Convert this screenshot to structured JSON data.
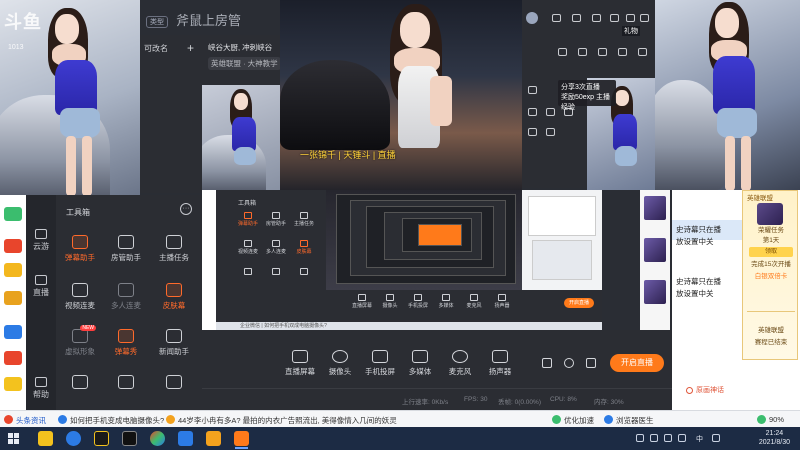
{
  "logo": {
    "mark": "斗鱼",
    "room": "1013"
  },
  "title_band": {
    "tag": "类型",
    "text": "斧鼠上房管"
  },
  "mid_panel": {
    "label": "可改名",
    "label2": "峡谷大厨, 冲刺峡谷",
    "add": "+"
  },
  "chat_panel": {
    "line1": "峡谷大厨, 冲刺峡谷",
    "line2": "英雄联盟 · 大神教学"
  },
  "popup": {
    "line1": "分享3次直播",
    "line2": "奖励50exp 主播经验"
  },
  "ctrl": {
    "highlight": "礼物"
  },
  "overlay": {
    "text": "一张锦千 | 天锤斗 | 直播"
  },
  "left_nav": [
    {
      "label": "云游"
    },
    {
      "label": "直播"
    },
    {
      "label": "帮助"
    }
  ],
  "tool_panel": {
    "title": "工具箱",
    "more": "···",
    "tools": [
      {
        "label": "弹幕助手",
        "state": "hot",
        "badge": ""
      },
      {
        "label": "房管助手",
        "state": "normal",
        "badge": ""
      },
      {
        "label": "主播任务",
        "state": "normal",
        "badge": ""
      },
      {
        "label": "视频连麦",
        "state": "normal",
        "badge": ""
      },
      {
        "label": "多人连麦",
        "state": "dim",
        "badge": ""
      },
      {
        "label": "皮肤幕",
        "state": "hot",
        "badge": ""
      },
      {
        "label": "虚拟形象",
        "state": "dim",
        "badge": "NEW"
      },
      {
        "label": "弹幕秀",
        "state": "hot",
        "badge": ""
      },
      {
        "label": "新闻助手",
        "state": "normal",
        "badge": ""
      }
    ]
  },
  "screen": {
    "title": "工具箱",
    "mini_tools": [
      "弹幕助手",
      "房管助手",
      "主播任务",
      "视频连麦",
      "多人连麦",
      "皮肤幕"
    ],
    "bottom": [
      "直播屏幕",
      "摄像头",
      "手机投屏",
      "多媒体",
      "麦克风",
      "扬声器"
    ],
    "live": "开启直播",
    "task": "企业微信 | 如何把手机双成电脑摄像头?"
  },
  "bottom_bar": {
    "items": [
      {
        "label": "直播屏幕",
        "icon": "monitor-icon"
      },
      {
        "label": "摄像头",
        "icon": "camera-icon"
      },
      {
        "label": "手机投屏",
        "icon": "phone-icon"
      },
      {
        "label": "多媒体",
        "icon": "media-icon"
      },
      {
        "label": "麦克风",
        "icon": "mic-icon"
      },
      {
        "label": "扬声器",
        "icon": "speaker-icon"
      }
    ],
    "live_button": "开启直播"
  },
  "status_bar": {
    "upload": "上行速率: 0Kb/s",
    "fps": "FPS: 30",
    "drop": "丢帧: 0(0.00%)",
    "cpu": "CPU: 8%",
    "mem": "内存: 30%"
  },
  "right_col": {
    "lines": [
      "史诗幕只在播",
      "放设置中关",
      "史诗幕只在播",
      "放设置中关"
    ],
    "footer": "原画神话"
  },
  "quest": {
    "header": "英雄联盟",
    "t1": "荣耀任务",
    "t2": "第1天",
    "t3": "完成15次开播",
    "t4": "白银双倍卡",
    "btn": "领取",
    "t5": "英雄联盟",
    "t6": "赛程已结束"
  },
  "ticker": {
    "source": "头条资讯",
    "headline1": "如何把手机变成电脑摄像头?",
    "headline2": "44岁李小冉有多A? 最拍的内衣广告照流出, 美得像情入几间的妖灵",
    "tool1": "优化加速",
    "tool2": "浏览器医生",
    "volume": "90%"
  },
  "taskbar": {
    "lang": "中",
    "time": "21:24",
    "date": "2021/8/30"
  },
  "colors": {
    "accent": "#ff7a1a",
    "panel": "#2b2d33",
    "taskbar": "#1c2b44"
  }
}
